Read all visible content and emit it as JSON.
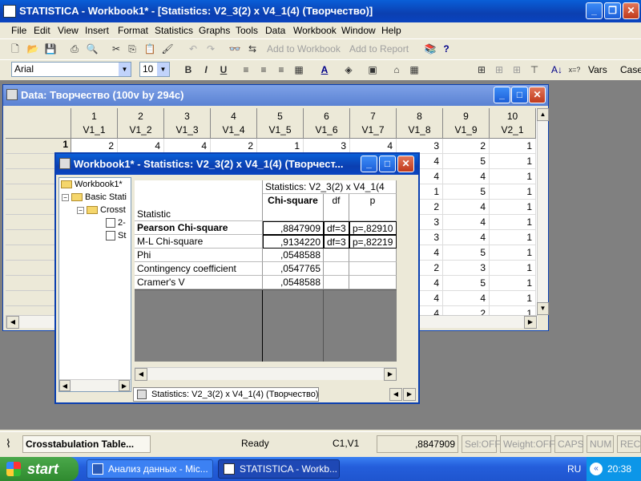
{
  "app": {
    "title": "STATISTICA - Workbook1* - [Statistics: V2_3(2) x V4_1(4) (Творчество)]",
    "menu": [
      "File",
      "Edit",
      "View",
      "Insert",
      "Format",
      "Statistics",
      "Graphs",
      "Tools",
      "Data",
      "Workbook",
      "Window",
      "Help"
    ]
  },
  "toolbar": {
    "add_to_workbook": "Add to Workbook",
    "add_to_report": "Add to Report",
    "font": "Arial",
    "font_size": "10",
    "bold": "B",
    "italic": "I",
    "underline": "U",
    "vars": "Vars",
    "cases": "Case"
  },
  "data_window": {
    "title": "Data: Творчество (100v by 294c)",
    "columns": [
      {
        "num": "1",
        "name": "V1_1"
      },
      {
        "num": "2",
        "name": "V1_2"
      },
      {
        "num": "3",
        "name": "V1_3"
      },
      {
        "num": "4",
        "name": "V1_4"
      },
      {
        "num": "5",
        "name": "V1_5"
      },
      {
        "num": "6",
        "name": "V1_6"
      },
      {
        "num": "7",
        "name": "V1_7"
      },
      {
        "num": "8",
        "name": "V1_8"
      },
      {
        "num": "9",
        "name": "V1_9"
      },
      {
        "num": "10",
        "name": "V2_1"
      }
    ],
    "row1": {
      "label": "1",
      "values": [
        "2",
        "4",
        "4",
        "2",
        "1",
        "3",
        "4",
        "3",
        "2",
        "1"
      ]
    },
    "visible_col8": [
      "4",
      "4",
      "1",
      "2",
      "3",
      "3",
      "4",
      "2",
      "4",
      "4",
      "4"
    ],
    "visible_col9": [
      "5",
      "4",
      "5",
      "4",
      "4",
      "4",
      "5",
      "3",
      "5",
      "4",
      "2"
    ],
    "visible_col10": [
      "1",
      "1",
      "1",
      "1",
      "1",
      "1",
      "1",
      "1",
      "1",
      "1",
      "1"
    ]
  },
  "workbook_window": {
    "title": "Workbook1* - Statistics: V2_3(2) x V4_1(4) (Творчест...",
    "tree": {
      "root": "Workbook1*",
      "basic": "Basic Stati",
      "cross": "Crosst",
      "leaf1": "2-",
      "leaf2": "St"
    },
    "sheet": {
      "super_header": "Statistics: V2_3(2) x V4_1(4",
      "col_statistic": "Statistic",
      "col_chi": "Chi-square",
      "col_df": "df",
      "col_p": "p",
      "rows": [
        {
          "stat": "Pearson Chi-square",
          "chi": ",8847909",
          "df": "df=3",
          "p": "p=,82910"
        },
        {
          "stat": "M-L Chi-square",
          "chi": ",9134220",
          "df": "df=3",
          "p": "p=,82219"
        },
        {
          "stat": "Phi",
          "chi": ",0548588",
          "df": "",
          "p": ""
        },
        {
          "stat": "Contingency coefficient",
          "chi": ",0547765",
          "df": "",
          "p": ""
        },
        {
          "stat": "Cramer's V",
          "chi": ",0548588",
          "df": "",
          "p": ""
        }
      ]
    },
    "tab_label": "Statistics: V2_3(2) x V4_1(4) (Творчество)"
  },
  "statusbar": {
    "task": "Crosstabulation Table...",
    "ready": "Ready",
    "cell": "C1,V1",
    "value": ",8847909",
    "sel": "Sel:OFF",
    "weight": "Weight:OFF",
    "caps": "CAPS",
    "num": "NUM",
    "rec": "REC"
  },
  "taskbar": {
    "start": "start",
    "task1": "Анализ данных - Mic...",
    "task2": "STATISTICA - Workb...",
    "lang": "RU",
    "time": "20:38"
  }
}
